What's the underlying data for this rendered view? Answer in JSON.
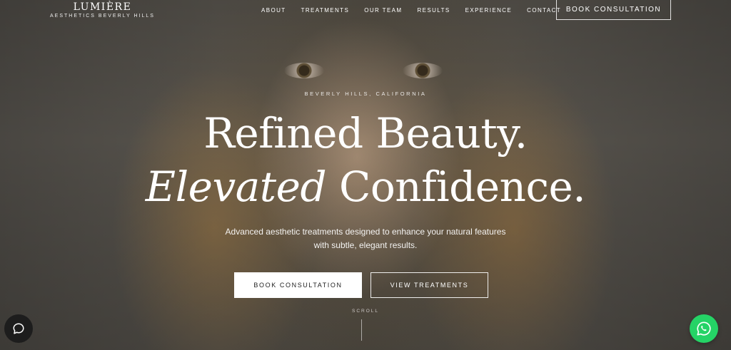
{
  "brand": {
    "name": "LUMIÈRE",
    "tagline": "AESTHETICS BEVERLY HILLS"
  },
  "nav": {
    "links": [
      "ABOUT",
      "TREATMENTS",
      "OUR TEAM",
      "RESULTS",
      "EXPERIENCE",
      "CONTACT"
    ],
    "cta_label": "BOOK CONSULTATION"
  },
  "hero": {
    "eyebrow": "BEVERLY HILLS, CALIFORNIA",
    "headline_line1": "Refined Beauty.",
    "headline_line2_italic": "Elevated",
    "headline_line2_rest": " Confidence.",
    "subtext": "Advanced aesthetic treatments designed to enhance your natural features with subtle, elegant results.",
    "primary_button": "BOOK CONSULTATION",
    "secondary_button": "VIEW TREATMENTS",
    "scroll_label": "SCROLL"
  },
  "widgets": {
    "chat_icon": "chat-bubble-icon",
    "whatsapp_icon": "whatsapp-icon"
  },
  "colors": {
    "whatsapp": "#25d366",
    "chat": "#1d1d1d",
    "text": "#ffffff"
  }
}
